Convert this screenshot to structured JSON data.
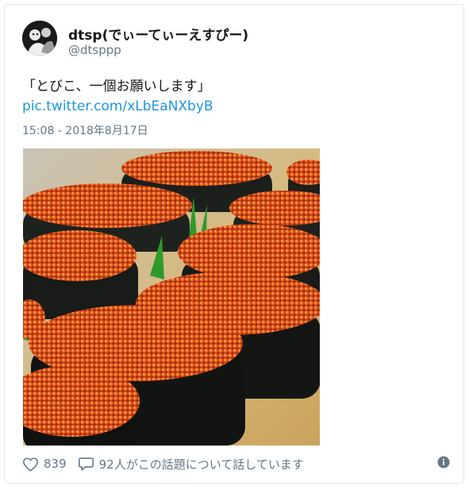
{
  "tweet": {
    "display_name": "dtsp(でぃーてぃーえすぴー)",
    "handle": "@dtsppp",
    "text": "「とびこ、一個お願いします」",
    "link": "pic.twitter.com/xLbEaNXbyB",
    "timestamp": "15:08 - 2018年8月17日",
    "media_icon": "sushi-photo",
    "avatar_icon": "avatar-photo"
  },
  "actions": {
    "like_icon": "heart-icon",
    "like_count": "839",
    "reply_icon": "speech-bubble-icon",
    "reply_label": "92人がこの話題について話しています",
    "info_icon": "info-icon"
  },
  "colors": {
    "link": "#1b95e0",
    "secondary_text": "#657786",
    "border": "#e1e8ed"
  }
}
